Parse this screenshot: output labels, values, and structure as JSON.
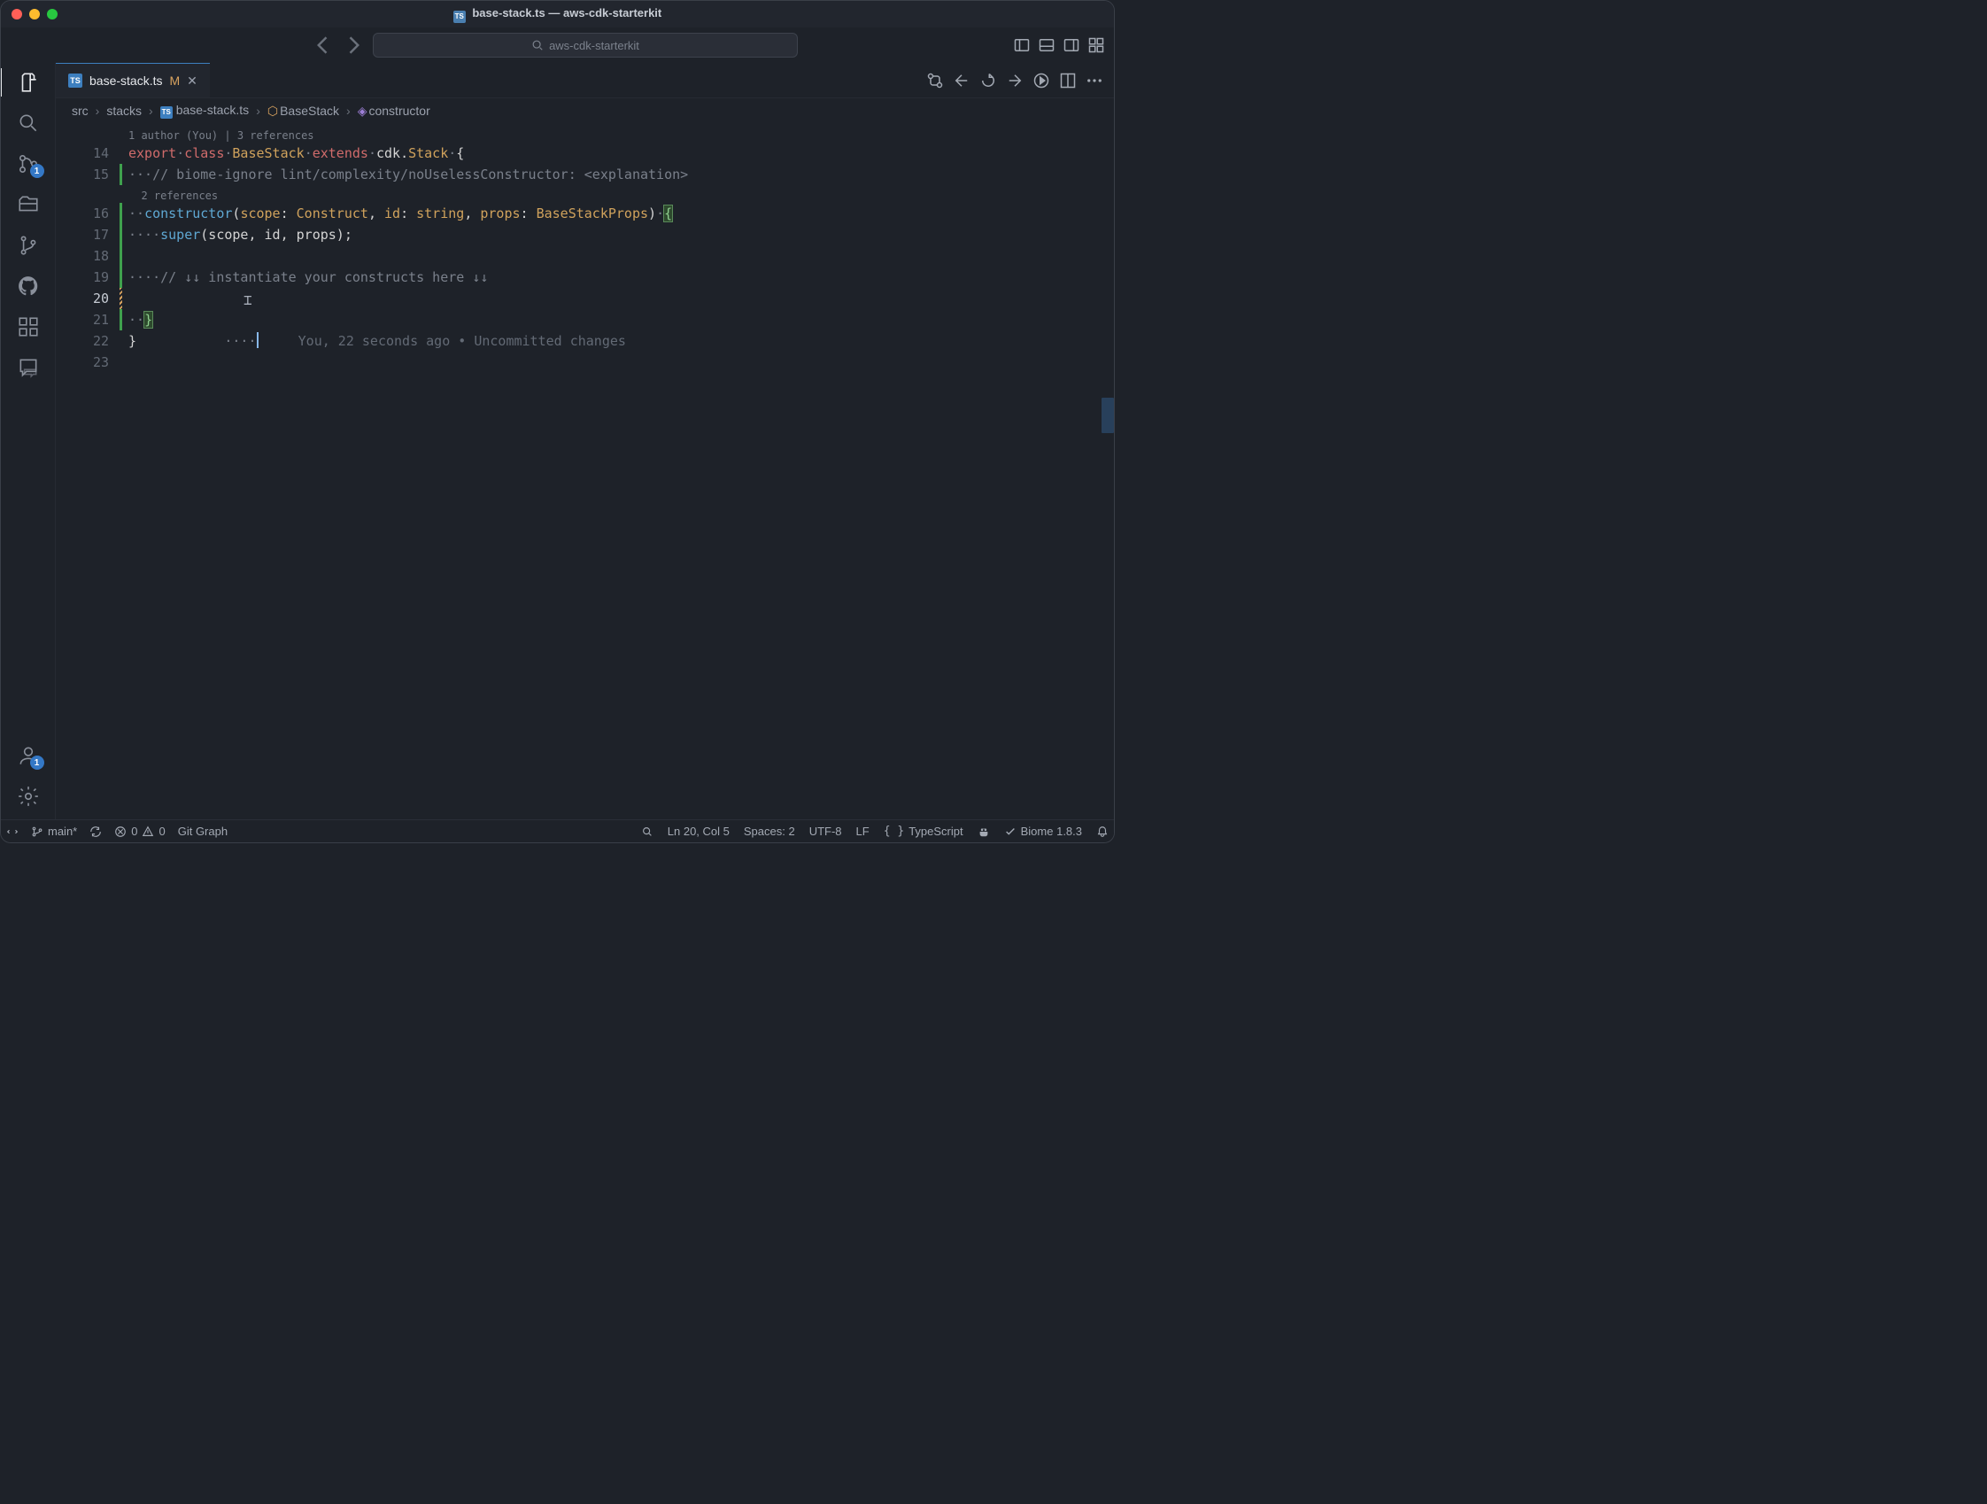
{
  "window": {
    "title_file": "base-stack.ts",
    "title_sep": " — ",
    "title_project": "aws-cdk-starterkit"
  },
  "search": {
    "placeholder": "aws-cdk-starterkit"
  },
  "activity": {
    "scm_badge": "1",
    "account_badge": "1"
  },
  "tab": {
    "filename": "base-stack.ts",
    "modified": "M"
  },
  "breadcrumb": {
    "src": "src",
    "stacks": "stacks",
    "file": "base-stack.ts",
    "class": "BaseStack",
    "member": "constructor"
  },
  "line_numbers": [
    "14",
    "15",
    "16",
    "17",
    "18",
    "19",
    "20",
    "21",
    "22",
    "23"
  ],
  "codelens": {
    "class": "1 author (You) | 3 references",
    "ctor": "2 references"
  },
  "code": {
    "l14": {
      "export": "export",
      "class": "class",
      "name": "BaseStack",
      "extends": "extends",
      "ns": "cdk",
      "dot": ".",
      "stack": "Stack",
      "open": " {"
    },
    "l15": {
      "dots": "···",
      "cmnt": "// biome-ignore lint/complexity/noUselessConstructor: <explanation>"
    },
    "l16": {
      "dots": "··",
      "ctor": "constructor",
      "open": "(",
      "p1": "scope",
      "c1": ": ",
      "t1": "Construct",
      "sep1": ", ",
      "p2": "id",
      "c2": ": ",
      "t2": "string",
      "sep2": ", ",
      "p3": "props",
      "c3": ": ",
      "t3": "BaseStackProps",
      "close": ")",
      "brace": " {"
    },
    "l17": {
      "dots": "····",
      "super": "super",
      "args": "(scope, id, props);"
    },
    "l18": {
      "blank": ""
    },
    "l19": {
      "dots": "····",
      "cmnt": "// ↓↓ instantiate your constructs here ↓↓"
    },
    "l20": {
      "dots": "····",
      "ghost": "You, 22 seconds ago • Uncommitted changes"
    },
    "l21": {
      "dots": "··",
      "close": "}"
    },
    "l22": {
      "close": "}"
    },
    "l23": {
      "blank": ""
    }
  },
  "status": {
    "remote_icon": "⇆",
    "branch": "main*",
    "sync": "↻",
    "errors": "0",
    "warnings": "0",
    "gitgraph": "Git Graph",
    "position": "Ln 20, Col 5",
    "spaces": "Spaces: 2",
    "encoding": "UTF-8",
    "eol": "LF",
    "language": "TypeScript",
    "copilot": "",
    "linter": "Biome 1.8.3"
  }
}
